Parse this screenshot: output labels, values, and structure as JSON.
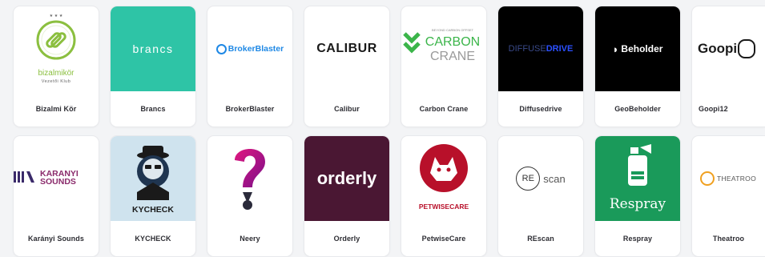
{
  "cards": [
    {
      "name": "Bizalmi Kör",
      "logo_text": "bizalmikör",
      "logo_subtext": "Vezetői Klub",
      "color": "#8bbf3f"
    },
    {
      "name": "Brancs",
      "logo_text": "brancs",
      "color": "#2ec4a6"
    },
    {
      "name": "BrokerBlaster",
      "logo_text": "BrokerBlaster",
      "color": "#1e88e5"
    },
    {
      "name": "Calibur",
      "logo_text": "CALIBUR",
      "color": "#1a1a1a"
    },
    {
      "name": "Carbon Crane",
      "logo_text_top": "CARBON",
      "logo_text_bottom": "CRANE",
      "logo_tagline": "BEYOND CARBON OFFSET",
      "color": "#3bb54a"
    },
    {
      "name": "Diffusedrive",
      "logo_text_a": "DIFFUSE",
      "logo_text_b": "DRIVE",
      "color": "#2b50ff"
    },
    {
      "name": "GeoBeholder",
      "logo_text": "Beholder",
      "color": "#000000"
    },
    {
      "name": "Goopi12",
      "logo_text": "Goopi",
      "color": "#1a1a1a"
    },
    {
      "name": "Karányi Sounds",
      "logo_text_top": "KARANYI",
      "logo_text_bottom": "SOUNDS",
      "color": "#8a2a6b"
    },
    {
      "name": "KYCHECK",
      "logo_text": "KYCHECK",
      "color": "#1f3550"
    },
    {
      "name": "Neery",
      "color": "#a3147f"
    },
    {
      "name": "Orderly",
      "logo_text": "orderly",
      "color": "#4a1733"
    },
    {
      "name": "PetwiseCare",
      "logo_text": "PETWISECARE",
      "color": "#b8102a"
    },
    {
      "name": "REscan",
      "logo_text_a": "RE",
      "logo_text_b": "scan",
      "color": "#333333"
    },
    {
      "name": "Respray",
      "logo_text": "Respray",
      "color": "#1a9a5a"
    },
    {
      "name": "Theatroo",
      "logo_text": "THEATROO",
      "color": "#f0a020"
    }
  ]
}
